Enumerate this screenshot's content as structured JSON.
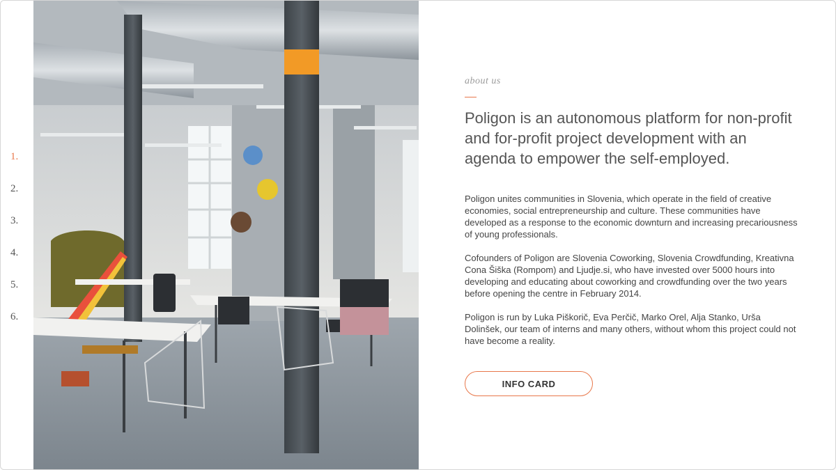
{
  "pager": {
    "items": [
      "1.",
      "2.",
      "3.",
      "4.",
      "5.",
      "6."
    ],
    "active_index": 0
  },
  "about": {
    "eyebrow": "about us",
    "headline": "Poligon is an autonomous platform for non-profit and for-profit project development with an agenda to empower the self-employed.",
    "paragraphs": [
      "Poligon unites communities in Slovenia, which operate in the field of creative economies, social entrepreneurship and culture. These communities have developed as a response to the economic downturn and increasing precariousness of young professionals.",
      "Cofounders of Poligon are Slovenia Coworking, Slovenia Crowdfunding, Kreativna Cona Šiška (Rompom) and Ljudje.si, who have invested over 5000 hours into developing and educating about coworking and crowdfunding over the two years before opening the centre in February 2014.",
      "Poligon is run by Luka Piškorič, Eva Perčič, Marko Orel, Alja Stanko, Urša Dolinšek, our team of interns and many others, without whom this project could not have become a reality."
    ],
    "button_label": "INFO CARD"
  },
  "colors": {
    "accent": "#e8774a",
    "text": "#444444",
    "muted": "#9a9a9a"
  }
}
